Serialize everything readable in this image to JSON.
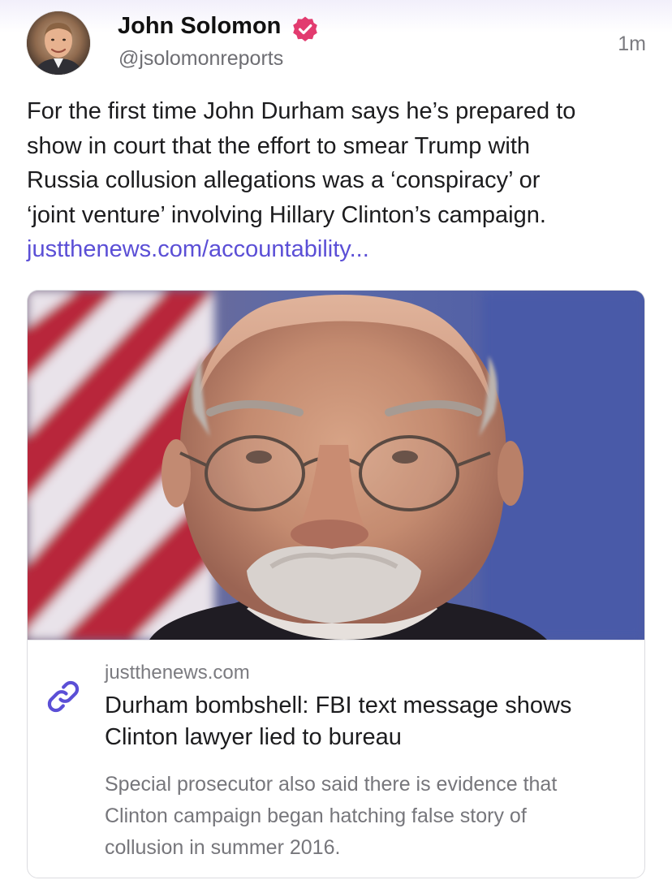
{
  "author": {
    "name": "John Solomon",
    "handle": "@jsolomonreports",
    "verified_icon": "verified-badge-icon",
    "avatar_icon": "avatar-photo"
  },
  "post": {
    "timestamp": "1m",
    "text_lines": [
      "For the first time John Durham says he’s prepared to",
      "show in court that the effort to smear Trump with",
      "Russia collusion allegations was a ‘conspiracy’ or",
      "‘joint venture’ involving Hillary Clinton’s campaign."
    ],
    "link_text": "justthenews.com/accountability..."
  },
  "link_card": {
    "icon": "link-icon",
    "domain": "justthenews.com",
    "title_lines": [
      "Durham bombshell: FBI text message shows",
      "Clinton lawyer lied to bureau"
    ],
    "description_lines": [
      "Special prosecutor also said there is evidence that",
      "Clinton campaign began hatching false story of",
      "collusion in summer 2016."
    ]
  },
  "colors": {
    "accent": "#5b4fd6",
    "verified_badge": "#e23b6f",
    "secondary_text": "#7b7b80",
    "card_border": "#dcdce0"
  }
}
